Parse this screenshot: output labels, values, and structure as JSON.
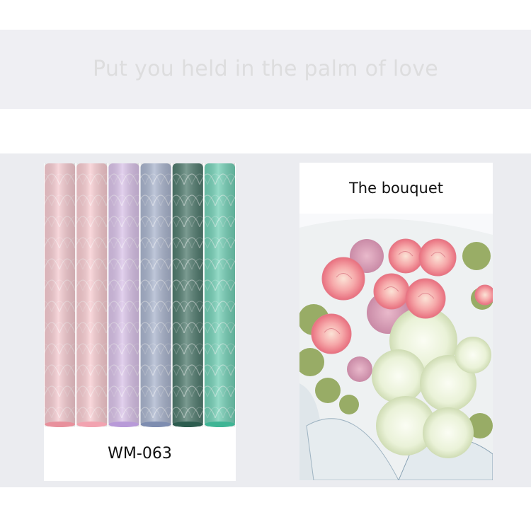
{
  "banner": {
    "text": "Put you held in the palm of love"
  },
  "product": {
    "code": "WM-063",
    "roll_colors": [
      "#f4c9cf",
      "#f7cbd0",
      "#d9c2e8",
      "#a9b4cd",
      "#4f7a6d",
      "#72cfb5"
    ],
    "edge_colors": [
      "#e8909c",
      "#f2a3b0",
      "#b89ad8",
      "#7e8db0",
      "#2d5d4f",
      "#3fb595"
    ]
  },
  "bouquet": {
    "title": "The bouquet"
  }
}
